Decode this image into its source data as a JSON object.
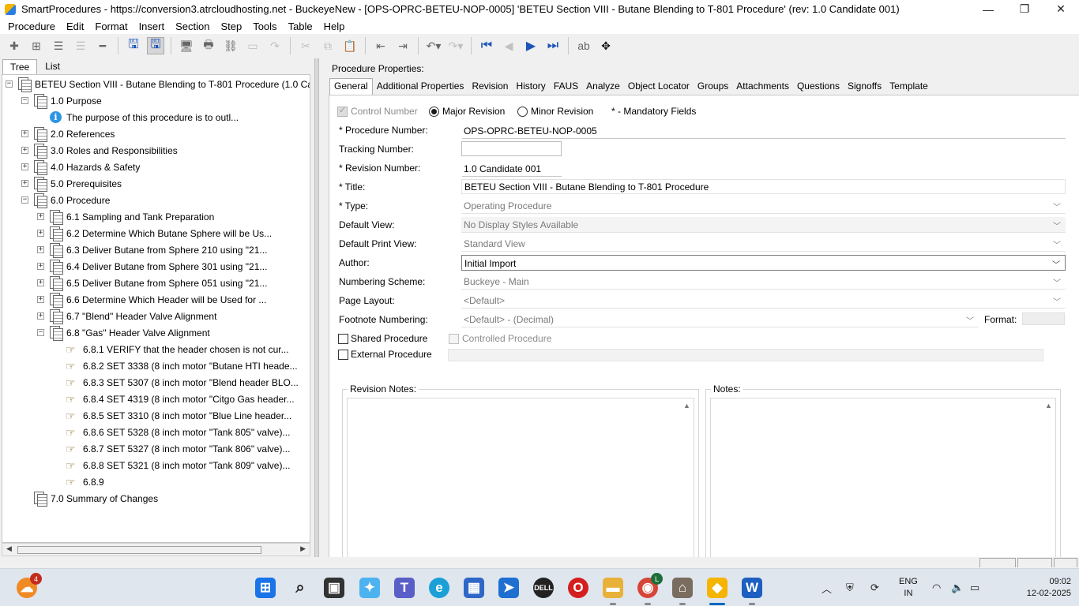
{
  "window": {
    "title": "SmartProcedures - https://conversion3.atrcloudhosting.net - BuckeyeNew - [OPS-OPRC-BETEU-NOP-0005] 'BETEU Section VIII - Butane Blending to T-801 Procedure' (rev: 1.0 Candidate 001)",
    "minimize": "—",
    "restore": "❐",
    "close": "✕"
  },
  "menu": {
    "items": [
      "Procedure",
      "Edit",
      "Format",
      "Insert",
      "Section",
      "Step",
      "Tools",
      "Table",
      "Help"
    ]
  },
  "left_panel": {
    "tabs": [
      "Tree",
      "List"
    ],
    "tree": [
      {
        "label": "BETEU Section VIII - Butane Blending to T-801 Procedure (1.0 Ca...",
        "level": 0,
        "expander": "-",
        "icon": "doc"
      },
      {
        "label": "1.0 Purpose",
        "level": 1,
        "expander": "-",
        "icon": "doc"
      },
      {
        "label": "The purpose of this procedure is to outl...",
        "level": 2,
        "expander": "",
        "icon": "info"
      },
      {
        "label": "2.0 References",
        "level": 1,
        "expander": "+",
        "icon": "doc"
      },
      {
        "label": "3.0 Roles and Responsibilities",
        "level": 1,
        "expander": "+",
        "icon": "doc"
      },
      {
        "label": "4.0 Hazards & Safety",
        "level": 1,
        "expander": "+",
        "icon": "doc"
      },
      {
        "label": "5.0 Prerequisites",
        "level": 1,
        "expander": "+",
        "icon": "doc"
      },
      {
        "label": "6.0 Procedure",
        "level": 1,
        "expander": "-",
        "icon": "doc"
      },
      {
        "label": "6.1 Sampling and Tank Preparation",
        "level": 2,
        "expander": "+",
        "icon": "doc"
      },
      {
        "label": "6.2 Determine Which Butane Sphere will be Us...",
        "level": 2,
        "expander": "+",
        "icon": "doc"
      },
      {
        "label": "6.3 Deliver Butane from Sphere 210 using \"21...",
        "level": 2,
        "expander": "+",
        "icon": "doc"
      },
      {
        "label": "6.4 Deliver Butane from Sphere 301 using \"21...",
        "level": 2,
        "expander": "+",
        "icon": "doc"
      },
      {
        "label": "6.5 Deliver Butane from Sphere 051 using \"21...",
        "level": 2,
        "expander": "+",
        "icon": "doc"
      },
      {
        "label": "6.6 Determine Which Header will be Used for ...",
        "level": 2,
        "expander": "+",
        "icon": "doc"
      },
      {
        "label": "6.7 \"Blend\" Header Valve Alignment",
        "level": 2,
        "expander": "+",
        "icon": "doc"
      },
      {
        "label": "6.8 \"Gas\" Header Valve Alignment",
        "level": 2,
        "expander": "-",
        "icon": "doc"
      },
      {
        "label": "6.8.1 VERIFY that the header chosen is not cur...",
        "level": 3,
        "expander": "",
        "icon": "hand"
      },
      {
        "label": "6.8.2 SET 3338 (8 inch motor \"Butane HTI heade...",
        "level": 3,
        "expander": "",
        "icon": "hand"
      },
      {
        "label": "6.8.3 SET 5307 (8 inch motor \"Blend header BLO...",
        "level": 3,
        "expander": "",
        "icon": "hand"
      },
      {
        "label": "6.8.4 SET 4319 (8 inch motor \"Citgo Gas header...",
        "level": 3,
        "expander": "",
        "icon": "hand"
      },
      {
        "label": "6.8.5 SET 3310 (8 inch motor \"Blue Line header...",
        "level": 3,
        "expander": "",
        "icon": "hand"
      },
      {
        "label": "6.8.6 SET 5328 (8 inch motor \"Tank 805\" valve)...",
        "level": 3,
        "expander": "",
        "icon": "hand"
      },
      {
        "label": "6.8.7 SET 5327 (8 inch motor \"Tank 806\" valve)...",
        "level": 3,
        "expander": "",
        "icon": "hand"
      },
      {
        "label": "6.8.8 SET 5321 (8 inch motor \"Tank 809\" valve)...",
        "level": 3,
        "expander": "",
        "icon": "hand"
      },
      {
        "label": "6.8.9",
        "level": 3,
        "expander": "",
        "icon": "hand"
      },
      {
        "label": "7.0 Summary of Changes",
        "level": 1,
        "expander": "",
        "icon": "doc"
      }
    ]
  },
  "right_panel": {
    "header": "Procedure Properties:",
    "tabs": [
      "General",
      "Additional Properties",
      "Revision",
      "History",
      "FAUS",
      "Analyze",
      "Object Locator",
      "Groups",
      "Attachments",
      "Questions",
      "Signoffs",
      "Template"
    ],
    "active_tab": "General",
    "control_number_label": "Control Number",
    "major_revision_label": "Major Revision",
    "minor_revision_label": "Minor Revision",
    "mandatory_note": "* - Mandatory Fields",
    "fields": {
      "procedure_number": {
        "label": "* Procedure Number:",
        "value": "OPS-OPRC-BETEU-NOP-0005"
      },
      "tracking_number": {
        "label": "Tracking Number:",
        "value": ""
      },
      "revision_number": {
        "label": "* Revision Number:",
        "value": "1.0 Candidate 001"
      },
      "title": {
        "label": "* Title:",
        "value": "BETEU Section VIII - Butane Blending to T-801 Procedure"
      },
      "type": {
        "label": "* Type:",
        "value": "Operating Procedure"
      },
      "default_view": {
        "label": "Default View:",
        "value": "No Display Styles Available"
      },
      "default_print_view": {
        "label": "Default Print View:",
        "value": "Standard View"
      },
      "author": {
        "label": "Author:",
        "value": "Initial Import"
      },
      "numbering_scheme": {
        "label": "Numbering Scheme:",
        "value": "Buckeye - Main"
      },
      "page_layout": {
        "label": "Page Layout:",
        "value": "<Default>"
      },
      "footnote_numbering": {
        "label": "Footnote Numbering:",
        "value": "<Default> - (Decimal)"
      },
      "format": {
        "label": "Format:",
        "value": ""
      }
    },
    "shared_procedure_label": "Shared Procedure",
    "controlled_procedure_label": "Controlled Procedure",
    "external_procedure_label": "External Procedure",
    "revision_notes_label": "Revision Notes:",
    "notes_label": "Notes:"
  },
  "taskbar": {
    "weather_badge": "4",
    "chrome_badge": "L",
    "lang_line1": "ENG",
    "lang_line2": "IN",
    "time": "09:02",
    "date": "12-02-2025"
  }
}
